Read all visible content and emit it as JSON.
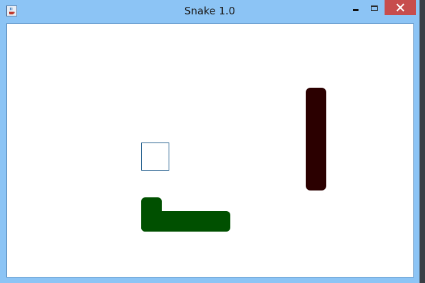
{
  "window": {
    "title": "Snake 1.0"
  },
  "titlebar": {
    "app_icon": "java-cup-icon",
    "buttons": [
      "minimize-icon",
      "maximize-icon",
      "close-icon"
    ],
    "close_color": "#c74d4d"
  },
  "game": {
    "background": "#ffffff",
    "food": {
      "color": "#1d5a8a"
    },
    "snakes": [
      {
        "color": "#005000"
      },
      {
        "color": "#2b0000"
      }
    ]
  }
}
